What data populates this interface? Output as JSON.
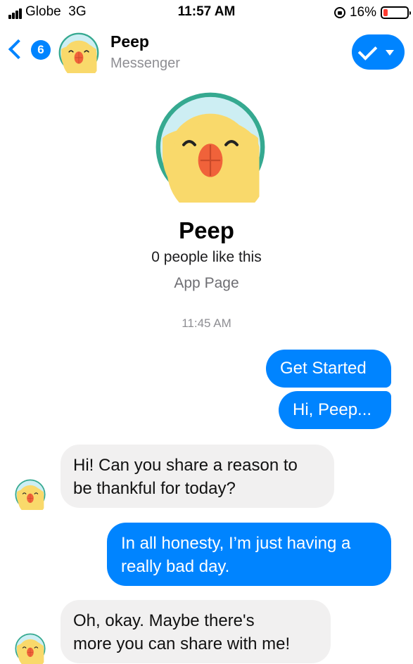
{
  "status_bar": {
    "carrier": "Globe",
    "network": "3G",
    "time": "11:57 AM",
    "battery": "16%",
    "icons": [
      "signal-icon",
      "orientation-lock-icon",
      "battery-icon"
    ],
    "battery_color": "#ff3b30"
  },
  "nav": {
    "back_badge": "6",
    "title": "Peep",
    "subtitle": "Messenger",
    "icons": [
      "back-chevron-icon",
      "checkmark-icon",
      "caret-down-icon"
    ],
    "accent_color": "#0084ff"
  },
  "profile": {
    "name": "Peep",
    "likes": "0 people like this",
    "category": "App Page",
    "avatar": "chick-face-avatar"
  },
  "conversation": {
    "timestamp": "11:45 AM",
    "messages": [
      {
        "from": "user",
        "text": "Get Started"
      },
      {
        "from": "user",
        "text": "Hi, Peep..."
      },
      {
        "from": "bot",
        "line1": "Hi! Can you share a reason to",
        "line2": "be thankful for today?"
      },
      {
        "from": "user",
        "line1": "In all honesty, I’m just having a",
        "line2": "really bad day."
      },
      {
        "from": "bot",
        "line1": "Oh, okay. Maybe there's",
        "line2": "more you can share with me!"
      }
    ]
  }
}
